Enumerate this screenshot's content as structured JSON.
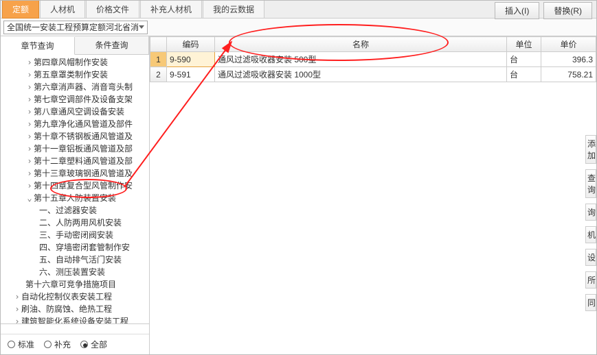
{
  "top_tabs": {
    "t0": "定额",
    "t1": "人材机",
    "t2": "价格文件",
    "t3": "补充人材机",
    "t4": "我的云数据"
  },
  "buttons": {
    "insert": "插入(I)",
    "replace": "替换(R)"
  },
  "combo_text": "全国统一安装工程预算定额河北省消",
  "left_tabs": {
    "chapter": "章节查询",
    "condition": "条件查询"
  },
  "tree": {
    "n0": "第四章风帽制作安装",
    "n1": "第五章罩类制作安装",
    "n2": "第六章消声器、消音弯头制",
    "n3": "第七章空调部件及设备支架",
    "n4": "第八章通风空调设备安装",
    "n5": "第九章净化通风管道及部件",
    "n6": "第十章不锈钢板通风管道及",
    "n7": "第十一章铝板通风管道及部",
    "n8": "第十二章塑料通风管道及部",
    "n9": "第十三章玻璃钢通风管道及",
    "n10": "第十四章复合型风管制作安",
    "n11": "第十五章人防装置安装",
    "c0": "一、过滤器安装",
    "c1": "二、人防两用风机安装",
    "c2": "三、手动密闭阀安装",
    "c3": "四、穿墙密闭套管制作安",
    "c4": "五、自动排气活门安装",
    "c5": "六、测压装置安装",
    "n12": "第十六章可竞争措施项目",
    "n13": "自动化控制仪表安装工程",
    "n14": "刷油、防腐蚀、绝热工程",
    "n15": "建筑智能化系统设备安装工程"
  },
  "filter": {
    "std": "标准",
    "sup": "补充",
    "all": "全部"
  },
  "table": {
    "h_code": "编码",
    "h_name": "名称",
    "h_unit": "单位",
    "h_price": "单价",
    "r1": {
      "idx": "1",
      "code": "9-590",
      "name": "通风过滤吸收器安装 500型",
      "unit": "台",
      "price": "396.3"
    },
    "r2": {
      "idx": "2",
      "code": "9-591",
      "name": "通风过滤吸收器安装 1000型",
      "unit": "台",
      "price": "758.21"
    }
  },
  "rightcut": {
    "a": "添加",
    "b": "查询",
    "c": "询",
    "d": "机",
    "e": "设",
    "f": "所",
    "g": "同"
  }
}
